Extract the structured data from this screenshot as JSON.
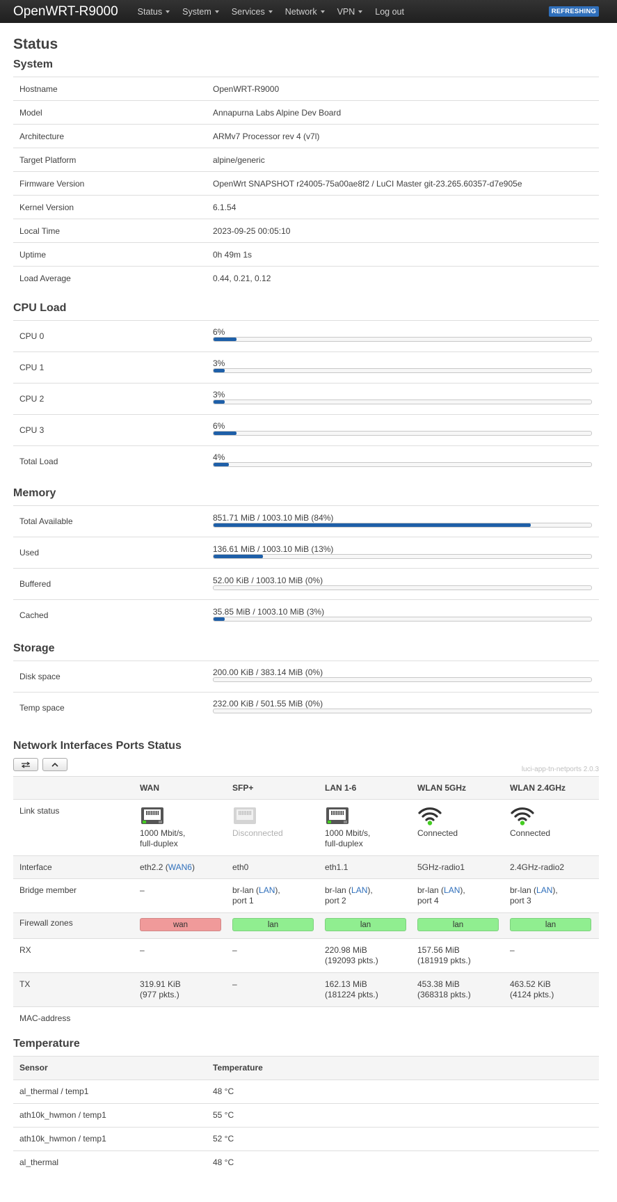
{
  "header": {
    "brand": "OpenWRT-R9000",
    "menu": [
      {
        "label": "Status",
        "dropdown": true
      },
      {
        "label": "System",
        "dropdown": true
      },
      {
        "label": "Services",
        "dropdown": true
      },
      {
        "label": "Network",
        "dropdown": true
      },
      {
        "label": "VPN",
        "dropdown": true
      },
      {
        "label": "Log out",
        "dropdown": false
      }
    ],
    "badge": "REFRESHING"
  },
  "page_title": "Status",
  "system": {
    "title": "System",
    "rows": [
      {
        "label": "Hostname",
        "value": "OpenWRT-R9000"
      },
      {
        "label": "Model",
        "value": "Annapurna Labs Alpine Dev Board"
      },
      {
        "label": "Architecture",
        "value": "ARMv7 Processor rev 4 (v7l)"
      },
      {
        "label": "Target Platform",
        "value": "alpine/generic"
      },
      {
        "label": "Firmware Version",
        "value": "OpenWrt SNAPSHOT r24005-75a00ae8f2 / LuCI Master git-23.265.60357-d7e905e"
      },
      {
        "label": "Kernel Version",
        "value": "6.1.54"
      },
      {
        "label": "Local Time",
        "value": "2023-09-25 00:05:10"
      },
      {
        "label": "Uptime",
        "value": "0h 49m 1s"
      },
      {
        "label": "Load Average",
        "value": "0.44, 0.21, 0.12"
      }
    ]
  },
  "cpu": {
    "title": "CPU Load",
    "rows": [
      {
        "label": "CPU 0",
        "text": "6%",
        "fraction": 0.06
      },
      {
        "label": "CPU 1",
        "text": "3%",
        "fraction": 0.03
      },
      {
        "label": "CPU 2",
        "text": "3%",
        "fraction": 0.03
      },
      {
        "label": "CPU 3",
        "text": "6%",
        "fraction": 0.06
      },
      {
        "label": "Total Load",
        "text": "4%",
        "fraction": 0.04
      }
    ]
  },
  "memory": {
    "title": "Memory",
    "rows": [
      {
        "label": "Total Available",
        "text": "851.71 MiB / 1003.10 MiB (84%)",
        "fraction": 0.84
      },
      {
        "label": "Used",
        "text": "136.61 MiB / 1003.10 MiB (13%)",
        "fraction": 0.13
      },
      {
        "label": "Buffered",
        "text": "52.00 KiB / 1003.10 MiB (0%)",
        "fraction": 0.0
      },
      {
        "label": "Cached",
        "text": "35.85 MiB / 1003.10 MiB (3%)",
        "fraction": 0.03
      }
    ]
  },
  "storage": {
    "title": "Storage",
    "rows": [
      {
        "label": "Disk space",
        "text": "200.00 KiB / 383.14 MiB (0%)",
        "fraction": 0.0
      },
      {
        "label": "Temp space",
        "text": "232.00 KiB / 501.55 MiB (0%)",
        "fraction": 0.0
      }
    ]
  },
  "ports": {
    "title": "Network Interfaces Ports Status",
    "version": "luci-app-tn-netports 2.0.3",
    "row_labels": {
      "link": "Link status",
      "interface": "Interface",
      "bridge": "Bridge member",
      "firewall": "Firewall zones",
      "rx": "RX",
      "tx": "TX",
      "mac": "MAC-address"
    },
    "columns": [
      {
        "name": "WAN",
        "icon": "ethernet-port-icon",
        "connected": true,
        "link_line1": "1000 Mbit/s,",
        "link_line2": "full-duplex",
        "iface": "eth2.2",
        "iface_link": "WAN6",
        "bridge_pre": "–",
        "bridge_link": "",
        "bridge_post": "",
        "bridge_port": "",
        "zone": "wan",
        "zone_color": "#f09a9a",
        "rx1": "–",
        "rx2": "",
        "tx1": "319.91 KiB",
        "tx2": "(977 pkts.)"
      },
      {
        "name": "SFP+",
        "icon": "sfp-port-icon",
        "connected": false,
        "link_line1": "Disconnected",
        "link_line2": "",
        "iface": "eth0",
        "iface_link": "",
        "bridge_pre": "br-lan (",
        "bridge_link": "LAN",
        "bridge_post": "),",
        "bridge_port": "port 1",
        "zone": "lan",
        "zone_color": "#90ee90",
        "rx1": "–",
        "rx2": "",
        "tx1": "–",
        "tx2": ""
      },
      {
        "name": "LAN 1-6",
        "icon": "ethernet-port-icon",
        "connected": true,
        "link_line1": "1000 Mbit/s,",
        "link_line2": "full-duplex",
        "iface": "eth1.1",
        "iface_link": "",
        "bridge_pre": "br-lan (",
        "bridge_link": "LAN",
        "bridge_post": "),",
        "bridge_port": "port 2",
        "zone": "lan",
        "zone_color": "#90ee90",
        "rx1": "220.98 MiB",
        "rx2": "(192093 pkts.)",
        "tx1": "162.13 MiB",
        "tx2": "(181224 pkts.)"
      },
      {
        "name": "WLAN 5GHz",
        "icon": "wifi-icon",
        "connected": true,
        "link_line1": "Connected",
        "link_line2": "",
        "iface": "5GHz-radio1",
        "iface_link": "",
        "bridge_pre": "br-lan (",
        "bridge_link": "LAN",
        "bridge_post": "),",
        "bridge_port": "port 4",
        "zone": "lan",
        "zone_color": "#90ee90",
        "rx1": "157.56 MiB",
        "rx2": "(181919 pkts.)",
        "tx1": "453.38 MiB",
        "tx2": "(368318 pkts.)"
      },
      {
        "name": "WLAN 2.4GHz",
        "icon": "wifi-icon",
        "connected": true,
        "link_line1": "Connected",
        "link_line2": "",
        "iface": "2.4GHz-radio2",
        "iface_link": "",
        "bridge_pre": "br-lan (",
        "bridge_link": "LAN",
        "bridge_post": "),",
        "bridge_port": "port 3",
        "zone": "lan",
        "zone_color": "#90ee90",
        "rx1": "–",
        "rx2": "",
        "tx1": "463.52 KiB",
        "tx2": "(4124 pkts.)"
      }
    ]
  },
  "temperature": {
    "title": "Temperature",
    "headers": [
      "Sensor",
      "Temperature"
    ],
    "rows": [
      {
        "sensor": "al_thermal / temp1",
        "value": "48 °C"
      },
      {
        "sensor": "ath10k_hwmon / temp1",
        "value": "55 °C"
      },
      {
        "sensor": "ath10k_hwmon / temp1",
        "value": "52 °C"
      },
      {
        "sensor": "al_thermal",
        "value": "48 °C"
      }
    ]
  },
  "colors": {
    "navbar": "#222222",
    "accent": "#1e5fa8",
    "badge": "#2f6fbb",
    "link": "#2f6fbb",
    "zone_wan": "#f09a9a",
    "zone_lan": "#90ee90",
    "link_ok": "#44cc22"
  }
}
